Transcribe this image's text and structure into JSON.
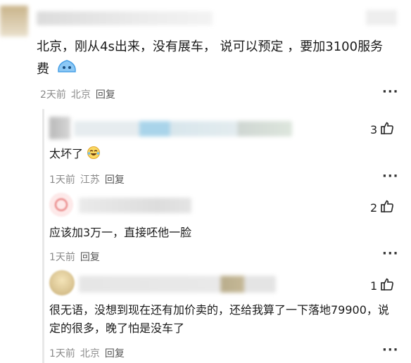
{
  "main_comment": {
    "text": "北京，刚从4s出来，没有展车，  说可以预定  ，要加3100服务费",
    "emoji": "emoji-blob-icon",
    "time": "2天前",
    "location": "北京",
    "reply_label": "回复"
  },
  "replies": [
    {
      "text": "太坏了",
      "emoji": "laughing-tears-emoji-icon",
      "time": "1天前",
      "location": "江苏",
      "reply_label": "回复",
      "likes": "3"
    },
    {
      "text": "应该加3万一，直接呸他一脸",
      "time": "1天前",
      "location": "",
      "reply_label": "回复",
      "likes": "2"
    },
    {
      "text": "很无语，没想到现在还有加价卖的，还给我算了一下落地79900，说定的很多，晚了怕是没车了",
      "time": "1天前",
      "location": "北京",
      "reply_label": "回复",
      "likes": "1"
    }
  ],
  "more_label": "···",
  "colors": {
    "meta": "#8a8a8a",
    "thread_line": "#e8e8e8"
  }
}
